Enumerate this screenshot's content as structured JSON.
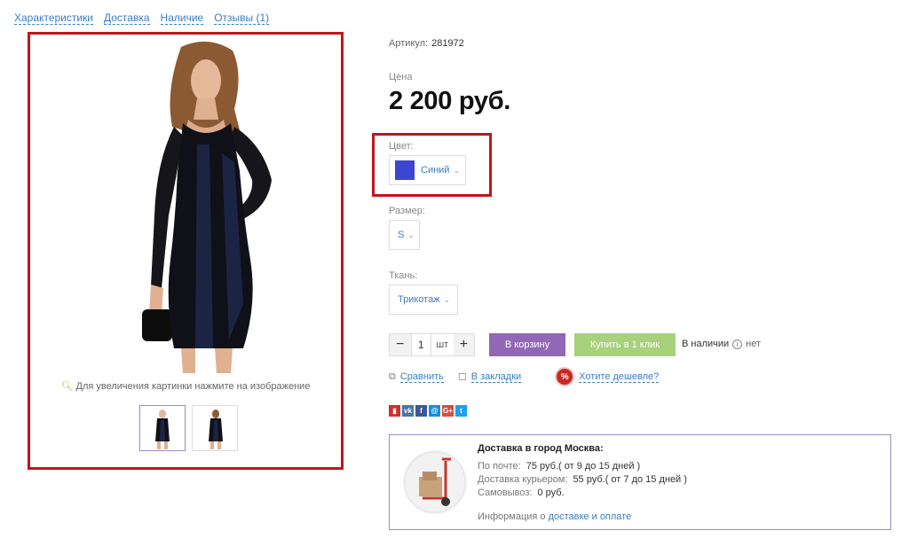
{
  "tabs": [
    "Характеристики",
    "Доставка",
    "Наличие",
    "Отзывы (1)"
  ],
  "gallery": {
    "zoom_hint": "Для увеличения картинки нажмите на изображение"
  },
  "product": {
    "sku_label": "Артикул:",
    "sku_value": "281972",
    "price_label": "Цена",
    "price": "2 200 руб."
  },
  "properties": {
    "color_label": "Цвет:",
    "color_value": "Синий",
    "color_swatch": "#3c46d2",
    "size_label": "Размер:",
    "size_value": "S",
    "fabric_label": "Ткань:",
    "fabric_value": "Трикотаж"
  },
  "purchase": {
    "minus": "−",
    "qty": "1",
    "unit": "шт",
    "plus": "+",
    "cart_button": "В корзину",
    "oneclick_button": "Купить в 1 клик",
    "stock_label": "В наличии",
    "stock_value": "нет"
  },
  "links": {
    "compare": "Сравнить",
    "bookmarks": "В закладки",
    "cheaper_badge": "%",
    "cheaper": "Хотите дешевле?"
  },
  "social": [
    {
      "name": "bookmark",
      "glyph": "▮",
      "color": "#d32f2f"
    },
    {
      "name": "vk",
      "glyph": "vk",
      "color": "#4a76a8"
    },
    {
      "name": "facebook",
      "glyph": "f",
      "color": "#3b5998"
    },
    {
      "name": "mail",
      "glyph": "@",
      "color": "#168de2"
    },
    {
      "name": "google-plus",
      "glyph": "G+",
      "color": "#dd4b39"
    },
    {
      "name": "twitter",
      "glyph": "t",
      "color": "#1da1f2"
    }
  ],
  "delivery": {
    "title": "Доставка в город Москва:",
    "rows": [
      {
        "label": "По почте:",
        "value": "75 руб.( от 9 до 15 дней )"
      },
      {
        "label": "Доставка курьером:",
        "value": "55 руб.( от 7 до 15 дней )"
      },
      {
        "label": "Самовывоз:",
        "value": "0 руб."
      }
    ],
    "info_prefix": "Информация о",
    "info_link": "доставке и оплате"
  }
}
